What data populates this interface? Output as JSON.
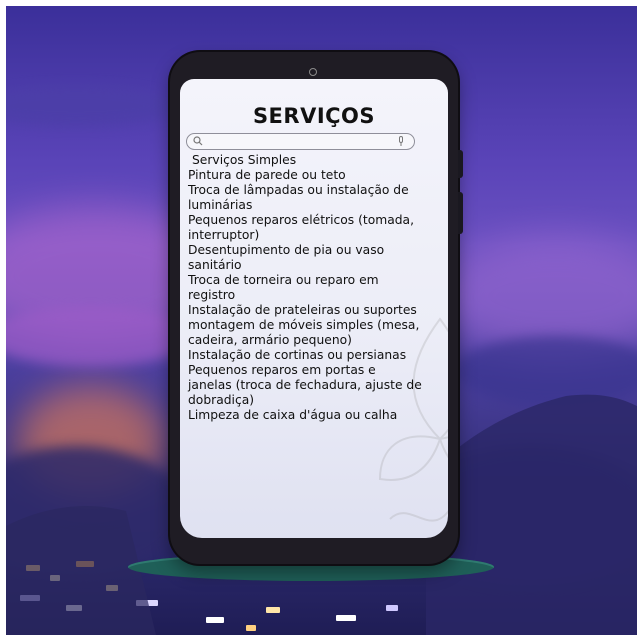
{
  "screen": {
    "title": "SERVIÇOS",
    "search": {
      "value": "",
      "placeholder": ""
    },
    "category": "Serviços Simples",
    "services": [
      "Pintura de parede ou teto",
      "Troca de lâmpadas ou instalação de",
      "luminárias",
      "Pequenos reparos elétricos (tomada,",
      "interruptor)",
      "Desentupimento de pia ou vaso",
      "sanitário",
      "Troca de torneira ou reparo em",
      "registro",
      "Instalação de prateleiras ou suportes",
      "montagem de móveis simples (mesa,",
      "cadeira, armário pequeno)",
      "Instalação de cortinas ou persianas",
      "Pequenos reparos em portas e",
      "janelas (troca de fechadura, ajuste de",
      "dobradiça)",
      "Limpeza de caixa d'água ou calha"
    ]
  },
  "icons": {
    "search": "search-icon",
    "mic": "mic-icon",
    "camera": "camera-icon"
  },
  "colors": {
    "sky_top": "#3b2f9a",
    "sky_mid": "#6a50c0",
    "phone_body": "#1f1c24",
    "screen_bg": "#eef0f8",
    "platform": "#1f5f58",
    "text": "#111111"
  }
}
